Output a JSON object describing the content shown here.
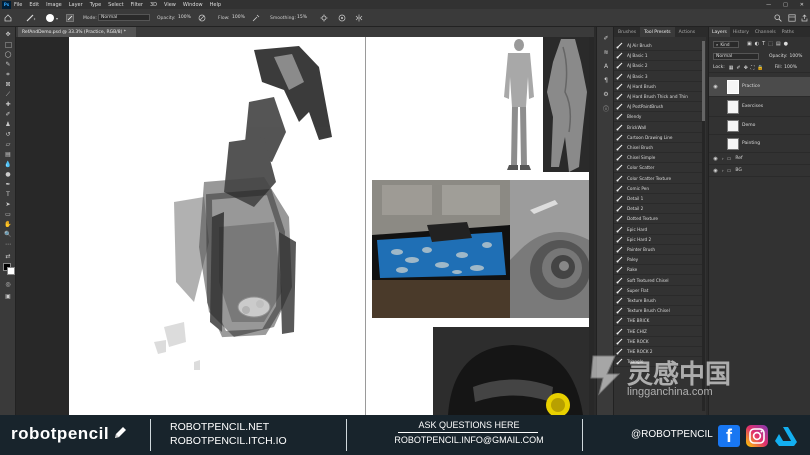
{
  "menubar": {
    "logo": "Ps",
    "items": [
      "File",
      "Edit",
      "Image",
      "Layer",
      "Type",
      "Select",
      "Filter",
      "3D",
      "View",
      "Window",
      "Help"
    ],
    "window_controls": [
      "—",
      "□",
      "✕"
    ]
  },
  "options": {
    "mode_label": "Mode:",
    "mode_value": "Normal",
    "opacity_label": "Opacity:",
    "opacity_value": "100%",
    "flow_label": "Flow:",
    "flow_value": "100%",
    "smoothing_label": "Smoothing:",
    "smoothing_value": "15%"
  },
  "document": {
    "tab_title": "RefAndDemo.psd @ 33.3% (Practice, RGB/8) *"
  },
  "brush_panel": {
    "tabs": [
      "Brushes",
      "Tool Presets",
      "Actions"
    ],
    "active_tab": "Tool Presets",
    "presets": [
      "AJ Air Brush",
      "AJ Basic 1",
      "AJ Basic 2",
      "AJ Basic 3",
      "AJ Hard Brush",
      "AJ Hard Brush Thick and Thin",
      "AJ PsstPaintBrush",
      "Blendy",
      "BrickWall",
      "Cartoon Drawing Line",
      "Chisel Brush",
      "Chisel Simple",
      "Color Scatter",
      "Color Scatter Texture",
      "Comic Pen",
      "Detail 1",
      "Detail 2",
      "Dotted Texture",
      "Epic Hard",
      "Epic Hard 2",
      "Painter Brush",
      "Paley",
      "Rake",
      "Soft Textured Chisel",
      "Super Flat",
      "Texture Brush",
      "Texture Brush Chisel",
      "THE BRICK",
      "THE CHIZ",
      "THE ROCK",
      "THE ROCK 2",
      "Triangle"
    ]
  },
  "layers_panel": {
    "tabs": [
      "Layers",
      "History",
      "Channels",
      "Paths"
    ],
    "kind_label": "Kind",
    "blend_mode": "Normal",
    "opacity_label": "Opacity:",
    "opacity_value": "100%",
    "lock_label": "Lock:",
    "fill_label": "Fill:",
    "fill_value": "100%",
    "layers": [
      {
        "name": "Practice",
        "visible": true,
        "selected": true,
        "type": "layer"
      },
      {
        "name": "Exercises",
        "visible": false,
        "type": "layer"
      },
      {
        "name": "Demo",
        "visible": false,
        "type": "layer"
      },
      {
        "name": "Painting",
        "visible": false,
        "type": "layer"
      },
      {
        "name": "Ref",
        "visible": true,
        "type": "group"
      },
      {
        "name": "BG",
        "visible": true,
        "type": "group"
      }
    ]
  },
  "footer": {
    "brand": "robotpencil",
    "site1": "ROBOTPENCIL.NET",
    "site2": "ROBOTPENCIL.ITCH.IO",
    "ask_heading": "ASK QUESTIONS HERE",
    "email": "ROBOTPENCIL.INFO@GMAIL.COM",
    "handle": "@ROBOTPENCIL"
  },
  "watermark": {
    "cn_text": "灵感中国",
    "url_text": "lingganchina.com"
  },
  "colors": {
    "accent": "#31a8ff",
    "footer_bg": "#18242c",
    "facebook": "#1877f2",
    "artstation": "#13aff0"
  }
}
